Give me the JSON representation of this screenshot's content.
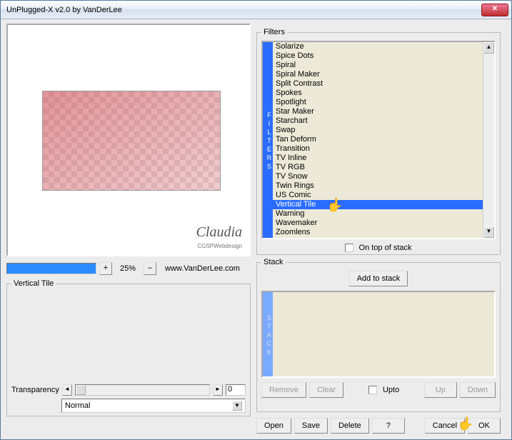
{
  "window": {
    "title": "UnPlugged-X v2.0 by VanDerLee"
  },
  "zoom": {
    "value": "25%",
    "plus": "+",
    "minus": "–",
    "url": "www.VanDerLee.com"
  },
  "vt": {
    "legend": "Vertical Tile",
    "slider_label": "Transparency",
    "slider_value": "0",
    "dropdown": "Normal"
  },
  "filters": {
    "legend": "Filters",
    "vlabel": "FILTERS",
    "items": [
      "Solarize",
      "Spice Dots",
      "Spiral",
      "Spiral Maker",
      "Split Contrast",
      "Spokes",
      "Spotlight",
      "Star Maker",
      "Starchart",
      "Swap",
      "Tan Deform",
      "Transition",
      "TV Inline",
      "TV RGB",
      "TV Snow",
      "Twin Rings",
      "US Comic",
      "Vertical Tile",
      "Warning",
      "Wavemaker",
      "Zoomlens"
    ],
    "selected_index": 17,
    "top_of_stack": "On top of stack"
  },
  "stack": {
    "legend": "Stack",
    "vlabel": "STACK",
    "add": "Add to stack",
    "remove": "Remove",
    "clear": "Clear",
    "upto": "Upto",
    "up": "Up",
    "down": "Down"
  },
  "buttons": {
    "open": "Open",
    "save": "Save",
    "delete": "Delete",
    "help": "?",
    "cancel": "Cancel",
    "ok": "OK"
  },
  "sig": {
    "name": "Claudia",
    "sub": "CGSPWebdesign"
  }
}
